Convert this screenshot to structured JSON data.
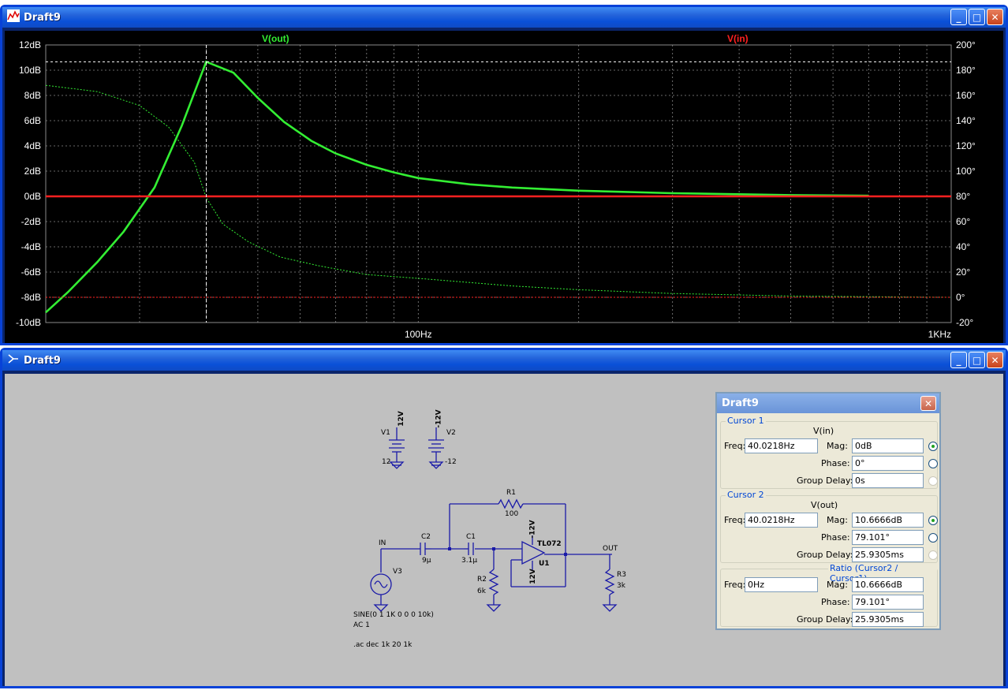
{
  "plot_window": {
    "title": "Draft9"
  },
  "schematic_window": {
    "title": "Draft9"
  },
  "window_buttons": {
    "minimize": "_",
    "maximize": "□",
    "close": "✕"
  },
  "trace_labels": {
    "vout": "V(out)",
    "vin": "V(in)"
  },
  "colors": {
    "vout": "#33ee33",
    "vin": "#ff2020",
    "grid": "#8a8a8a",
    "axis_text": "#ffffff",
    "background": "#000000",
    "schematic_wire": "#1a1aa8"
  },
  "chart_data": {
    "type": "line",
    "x_scale": "log",
    "xlim": [
      20,
      1000
    ],
    "x_tick_labels": [
      "100Hz",
      "1KHz"
    ],
    "y_left_label_unit": "dB",
    "ylim_left": [
      -10,
      12
    ],
    "y_left_ticks": [
      "12dB",
      "10dB",
      "8dB",
      "6dB",
      "4dB",
      "2dB",
      "0dB",
      "-2dB",
      "-4dB",
      "-6dB",
      "-8dB",
      "-10dB"
    ],
    "ylim_right": [
      -20,
      200
    ],
    "y_right_ticks": [
      "200°",
      "180°",
      "160°",
      "140°",
      "120°",
      "100°",
      "80°",
      "60°",
      "40°",
      "20°",
      "0°",
      "-20°"
    ],
    "cursor_x": 40.0218,
    "cursor_y_db": 10.6666,
    "series": [
      {
        "name": "V(out)",
        "kind": "magnitude",
        "x": [
          20,
          22,
          25,
          28,
          32,
          36,
          40,
          45,
          50,
          56,
          63,
          70,
          80,
          90,
          100,
          125,
          150,
          200,
          300,
          500,
          700
        ],
        "y": [
          -9.2,
          -7.6,
          -5.2,
          -2.8,
          0.7,
          5.6,
          10.67,
          9.8,
          7.8,
          5.9,
          4.4,
          3.4,
          2.5,
          1.9,
          1.45,
          0.95,
          0.7,
          0.45,
          0.25,
          0.1,
          0.05
        ]
      },
      {
        "name": "V(out)",
        "kind": "phase",
        "x": [
          20,
          25,
          30,
          34,
          38,
          40,
          43,
          48,
          55,
          65,
          80,
          100,
          150,
          200,
          300,
          500,
          700,
          1000
        ],
        "y": [
          168,
          163,
          152,
          135,
          107,
          79,
          58,
          44,
          32,
          25,
          18,
          15,
          9,
          6,
          3,
          1,
          0.5,
          0
        ]
      },
      {
        "name": "V(in)",
        "kind": "magnitude",
        "x": [
          20,
          1000
        ],
        "y": [
          0,
          0
        ]
      },
      {
        "name": "V(in)",
        "kind": "phase",
        "x": [
          20,
          1000
        ],
        "y": [
          0,
          0
        ]
      }
    ]
  },
  "schematic": {
    "labels": {
      "v1": "V1",
      "v1_volt": "12V",
      "v1_val": "12",
      "v2": "V2",
      "v2_volt": "-12V",
      "v2_val": "-12",
      "r1": "R1",
      "r1_val": "100",
      "c2": "C2",
      "c2_val": "9µ",
      "c1": "C1",
      "c1_val": "3.1µ",
      "r2": "R2",
      "r2_val": "6k",
      "r3": "R3",
      "r3_val": "3k",
      "u1": "U1",
      "u1_part": "TL072",
      "opamp_vneg": "-12V",
      "opamp_vpos": "12V",
      "v3": "V3",
      "in_net": "IN",
      "out_net": "OUT",
      "source_cmd": "SINE(0 1 1K 0 0 0 10k)",
      "ac_cmd": "AC 1",
      "sim_cmd": ".ac dec 1k 20 1k"
    }
  },
  "cursor_dialog": {
    "title": "Draft9",
    "cursor1": {
      "group_title": "Cursor 1",
      "trace": "V(in)",
      "freq_label": "Freq:",
      "freq": "40.0218Hz",
      "mag_label": "Mag:",
      "mag": "0dB",
      "phase_label": "Phase:",
      "phase": "0°",
      "gd_label": "Group Delay:",
      "gd": "0s"
    },
    "cursor2": {
      "group_title": "Cursor 2",
      "trace": "V(out)",
      "freq_label": "Freq:",
      "freq": "40.0218Hz",
      "mag_label": "Mag:",
      "mag": "10.6666dB",
      "phase_label": "Phase:",
      "phase": "79.101°",
      "gd_label": "Group Delay:",
      "gd": "25.9305ms"
    },
    "ratio": {
      "group_title": "Ratio (Cursor2 / Cursor1)",
      "freq_label": "Freq:",
      "freq": "0Hz",
      "mag_label": "Mag:",
      "mag": "10.6666dB",
      "phase_label": "Phase:",
      "phase": "79.101°",
      "gd_label": "Group Delay:",
      "gd": "25.9305ms"
    }
  }
}
